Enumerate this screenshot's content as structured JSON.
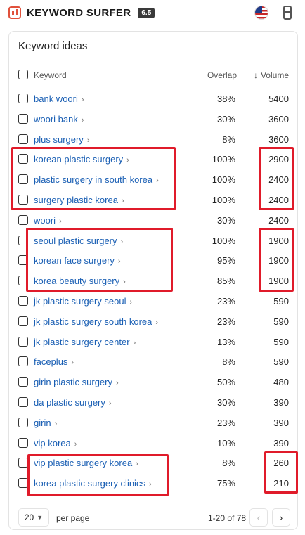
{
  "app": {
    "brand": "KEYWORD SURFER",
    "version": "6.5",
    "flag_icon": "us-flag-icon",
    "extension_icon": "extension-icon",
    "accent_color": "#e0513b"
  },
  "panel": {
    "title": "Keyword ideas",
    "columns": {
      "keyword": "Keyword",
      "overlap": "Overlap",
      "volume_arrow": "↓",
      "volume": "Volume"
    },
    "rows": [
      {
        "keyword": "bank woori",
        "overlap": "38%",
        "volume": "5400"
      },
      {
        "keyword": "woori bank",
        "overlap": "30%",
        "volume": "3600"
      },
      {
        "keyword": "plus surgery",
        "overlap": "8%",
        "volume": "3600"
      },
      {
        "keyword": "korean plastic surgery",
        "overlap": "100%",
        "volume": "2900"
      },
      {
        "keyword": "plastic surgery in south korea",
        "overlap": "100%",
        "volume": "2400"
      },
      {
        "keyword": "surgery plastic korea",
        "overlap": "100%",
        "volume": "2400"
      },
      {
        "keyword": "woori",
        "overlap": "30%",
        "volume": "2400"
      },
      {
        "keyword": "seoul plastic surgery",
        "overlap": "100%",
        "volume": "1900"
      },
      {
        "keyword": "korean face surgery",
        "overlap": "95%",
        "volume": "1900"
      },
      {
        "keyword": "korea beauty surgery",
        "overlap": "85%",
        "volume": "1900"
      },
      {
        "keyword": "jk plastic surgery seoul",
        "overlap": "23%",
        "volume": "590"
      },
      {
        "keyword": "jk plastic surgery south korea",
        "overlap": "23%",
        "volume": "590"
      },
      {
        "keyword": "jk plastic surgery center",
        "overlap": "13%",
        "volume": "590"
      },
      {
        "keyword": "faceplus",
        "overlap": "8%",
        "volume": "590"
      },
      {
        "keyword": "girin plastic surgery",
        "overlap": "50%",
        "volume": "480"
      },
      {
        "keyword": "da plastic surgery",
        "overlap": "30%",
        "volume": "390"
      },
      {
        "keyword": "girin",
        "overlap": "23%",
        "volume": "390"
      },
      {
        "keyword": "vip korea",
        "overlap": "10%",
        "volume": "390"
      },
      {
        "keyword": "vip plastic surgery korea",
        "overlap": "8%",
        "volume": "260"
      },
      {
        "keyword": "korea plastic surgery clinics",
        "overlap": "75%",
        "volume": "210"
      }
    ],
    "highlight_color": "#e01b2a"
  },
  "footer": {
    "per_page_value": "20",
    "per_page_label": "per page",
    "range": "1-20 of 78",
    "prev_icon": "‹",
    "next_icon": "›"
  }
}
